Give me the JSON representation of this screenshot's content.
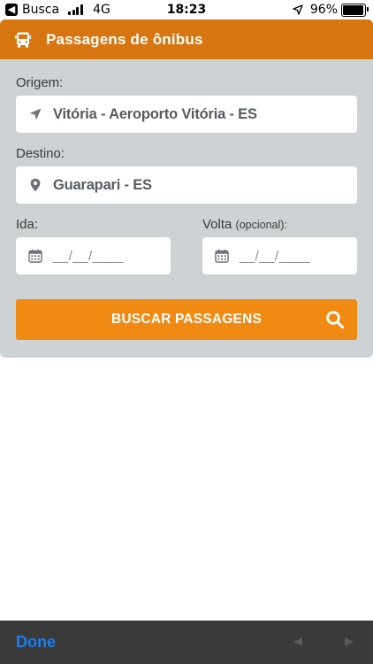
{
  "status_bar": {
    "back_glyph": "◀",
    "back_app": "Busca",
    "network": "4G",
    "time": "18:23",
    "battery": "96%",
    "battery_level": 0.96
  },
  "widget": {
    "title": "Passagens de ônibus",
    "header_color": "#d77511",
    "icon": "bus-icon"
  },
  "form": {
    "origin": {
      "label": "Origem:",
      "value": "Vitória - Aeroporto Vitória - ES",
      "icon": "location-arrow-icon"
    },
    "destination": {
      "label": "Destino:",
      "value": "Guarapari - ES",
      "icon": "map-pin-icon"
    },
    "departure": {
      "label": "Ida:",
      "placeholder": "__/__/____",
      "icon": "calendar-icon"
    },
    "return": {
      "label": "Volta",
      "optional": "(opcional):",
      "placeholder": "__/__/____",
      "icon": "calendar-icon"
    },
    "search_button": {
      "label": "BUSCAR PASSAGENS",
      "color": "#f08a12",
      "icon": "search-icon"
    }
  },
  "keyboard_bar": {
    "done": "Done",
    "prev_icon": "prev-arrow-icon",
    "next_icon": "next-arrow-icon"
  }
}
